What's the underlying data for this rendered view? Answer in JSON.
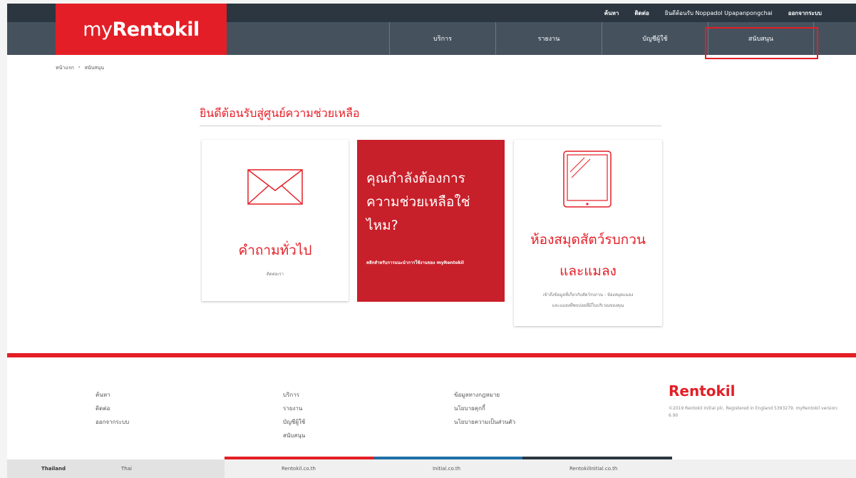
{
  "topbar": {
    "search": "ค้นหา",
    "contact": "ติดต่อ",
    "welcome_user": "ยินดีต้อนรับ Noppadol Upapanpongchai",
    "logout": "ออกจากระบบ"
  },
  "brand": {
    "logo_prefix": "my",
    "logo_main": "Rentokil"
  },
  "nav": {
    "items": [
      {
        "label": "บริการ"
      },
      {
        "label": "รายงาน"
      },
      {
        "label": "บัญชีผู้ใช้"
      },
      {
        "label": "สนับสนุน"
      }
    ]
  },
  "breadcrumb": {
    "home": "หน้าแรก",
    "current": "สนับสนุน"
  },
  "main": {
    "heading": "ยินดีต้อนรับสู่ศูนย์ความช่วยเหลือ",
    "card_general": {
      "title": "คำถามทั่วไป",
      "subtitle": "ติดต่อเรา"
    },
    "card_help": {
      "line1": "คุณกำลังต้องการ",
      "line2": "ความช่วยเหลือใช่",
      "line3": "ไหม?",
      "subtitle": "คลิกสำหรับการแนะนำการใช้งานของ myRentokil"
    },
    "card_library": {
      "title_line1": "ห้องสมุดสัตว์รบกวน",
      "title_line2": "และแมลง",
      "desc_line1": "เข้าถึงข้อมูลที่เกี่ยวกับสัตว์รบกวน - ห้องสมุดแมลง",
      "desc_line2": "และแมลงที่พบบ่อยที่มีในบริเวณของคุณ"
    }
  },
  "footer": {
    "col1": [
      "ค้นหา",
      "ติดต่อ",
      "ออกจากระบบ"
    ],
    "col2": [
      "บริการ",
      "รายงาน",
      "บัญชีผู้ใช้",
      "สนับสนุน"
    ],
    "col3": [
      "ข้อมูลทางกฎหมาย",
      "นโยบายคุกกี้",
      "นโยบายความเป็นส่วนตัว"
    ],
    "brand": "Rentokil",
    "copyright": "©2019 Rentokil Initial plc. Registered in England 5393279. myRentokil version: 6.90"
  },
  "bottombar": {
    "country": "Thailand",
    "language": "Thai",
    "link1": "Rentokil.co.th",
    "link2": "Initial.co.th",
    "link3": "RentokilInitial.co.th"
  },
  "colors": {
    "brand_red": "#e41e26",
    "card_red": "#c8202a",
    "nav_dark": "#2b3640",
    "nav_mid": "#45525e"
  }
}
